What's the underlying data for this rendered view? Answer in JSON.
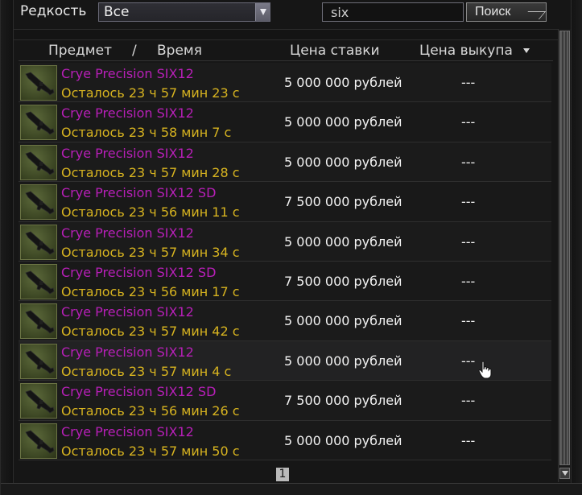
{
  "filter": {
    "rarity_label": "Редкость",
    "rarity_value": "Все",
    "search_value": "six",
    "search_button": "Поиск"
  },
  "columns": {
    "item": "Предмет",
    "separator": "/",
    "time": "Время",
    "bid": "Цена ставки",
    "buyout": "Цена выкупа"
  },
  "rows": [
    {
      "name": "Crye Precision SIX12",
      "time_left": "Осталось 23 ч 57 мин 23 с",
      "bid": "5 000 000 рублей",
      "buyout": "---"
    },
    {
      "name": "Crye Precision SIX12",
      "time_left": "Осталось 23 ч 58 мин 7 с",
      "bid": "5 000 000 рублей",
      "buyout": "---"
    },
    {
      "name": "Crye Precision SIX12",
      "time_left": "Осталось 23 ч 57 мин 28 с",
      "bid": "5 000 000 рублей",
      "buyout": "---"
    },
    {
      "name": "Crye Precision SIX12 SD",
      "time_left": "Осталось 23 ч 56 мин 11 с",
      "bid": "7 500 000 рублей",
      "buyout": "---"
    },
    {
      "name": "Crye Precision SIX12",
      "time_left": "Осталось 23 ч 57 мин 34 с",
      "bid": "5 000 000 рублей",
      "buyout": "---"
    },
    {
      "name": "Crye Precision SIX12 SD",
      "time_left": "Осталось 23 ч 56 мин 17 с",
      "bid": "7 500 000 рублей",
      "buyout": "---"
    },
    {
      "name": "Crye Precision SIX12",
      "time_left": "Осталось 23 ч 57 мин 42 с",
      "bid": "5 000 000 рублей",
      "buyout": "---"
    },
    {
      "name": "Crye Precision SIX12",
      "time_left": "Осталось 23 ч 57 мин 4 с",
      "bid": "5 000 000 рублей",
      "buyout": "---"
    },
    {
      "name": "Crye Precision SIX12 SD",
      "time_left": "Осталось 23 ч 56 мин 26 с",
      "bid": "7 500 000 рублей",
      "buyout": "---"
    },
    {
      "name": "Crye Precision SIX12",
      "time_left": "Осталось 23 ч 57 мин 50 с",
      "bid": "5 000 000 рублей",
      "buyout": "---"
    }
  ],
  "pagination": {
    "current_page": "1"
  },
  "colors": {
    "item_name": "#b81fb8",
    "time_left": "#d8b420",
    "text": "#f2f2f2"
  },
  "icons": {
    "rarity_dropdown": "chevron-down-icon",
    "sort": "sort-down-icon",
    "thumbnail": "shotgun-icon",
    "cursor": "hand-pointer-icon"
  }
}
